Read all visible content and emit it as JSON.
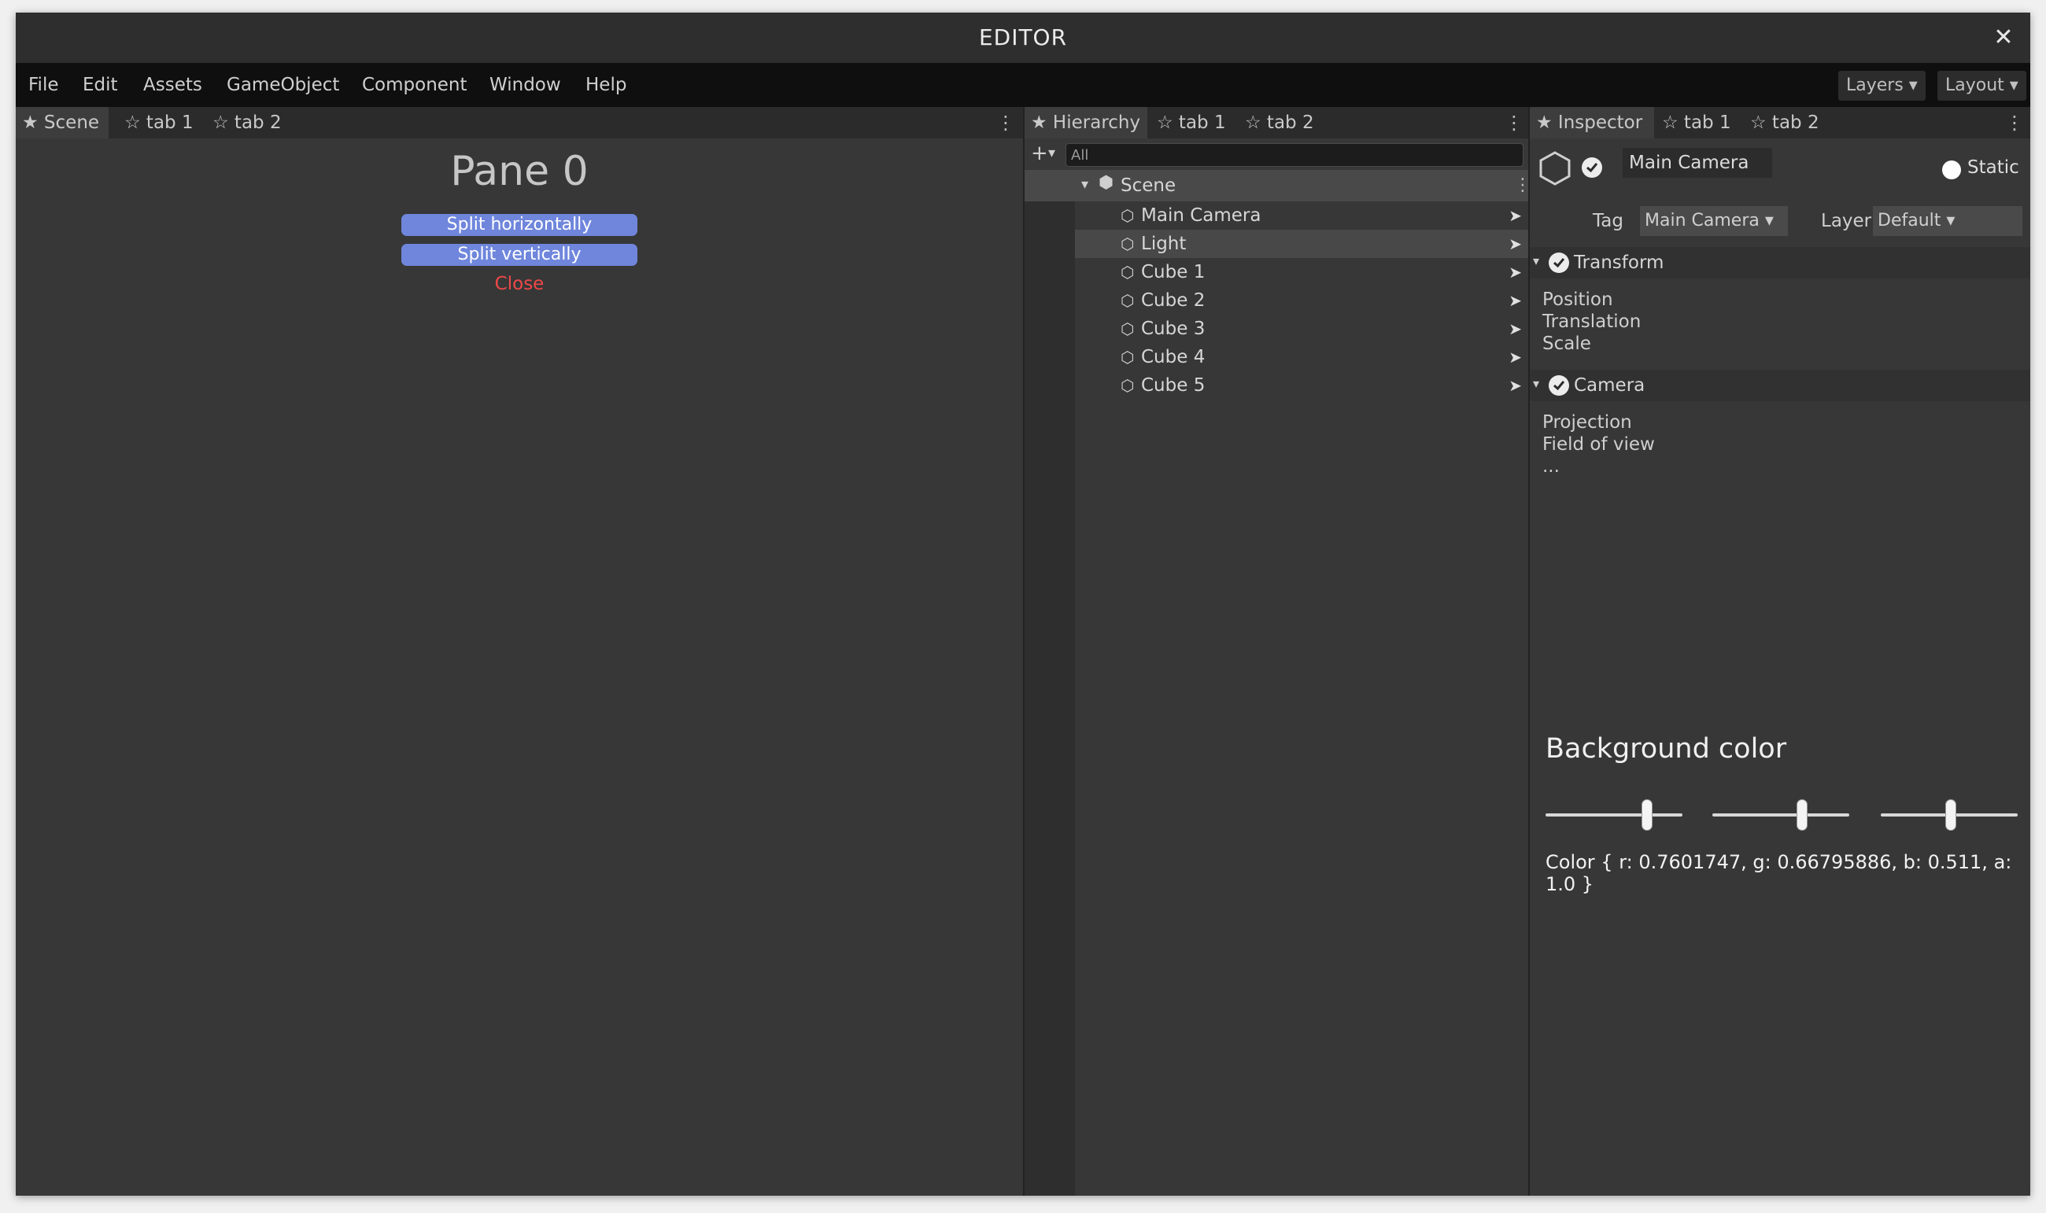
{
  "window": {
    "title": "EDITOR",
    "close_label": "✕"
  },
  "menu": {
    "items": [
      "File",
      "Edit",
      "Assets",
      "GameObject",
      "Component",
      "Window",
      "Help"
    ],
    "layers_label": "Layers ▾",
    "layout_label": "Layout ▾"
  },
  "scene_pane": {
    "tabs": [
      "★ Scene",
      "☆ tab 1",
      "☆ tab 2"
    ],
    "menu_glyph": "⋮",
    "title": "Pane 0",
    "split_h_label": "Split horizontally",
    "split_v_label": "Split vertically",
    "close_label": "Close"
  },
  "hierarchy": {
    "tabs": [
      "★ Hierarchy",
      "☆ tab 1",
      "☆ tab 2"
    ],
    "menu_glyph": "⋮",
    "add_glyph": "+",
    "dropdown_glyph": "▾",
    "search_placeholder": "All",
    "scene_caret": "▾",
    "scene_icon": "⬢",
    "scene_label": "Scene",
    "scene_menu_glyph": "⋮",
    "item_icon": "⬡",
    "item_arrow": "➤",
    "items": [
      "Main Camera",
      "Light",
      "Cube 1",
      "Cube 2",
      "Cube 3",
      "Cube 4",
      "Cube 5"
    ],
    "selected_index": 1
  },
  "inspector": {
    "tabs": [
      "★ Inspector",
      "☆ tab 1",
      "☆ tab 2"
    ],
    "menu_glyph": "⋮",
    "object_name": "Main Camera",
    "static_label": "Static",
    "tag_label": "Tag",
    "tag_value": "Main Camera ▾",
    "layer_label": "Layer",
    "layer_value": "Default ▾",
    "section_caret": "▾",
    "sections": [
      {
        "title": "Transform",
        "props": [
          "Position",
          "Translation",
          "Scale"
        ]
      },
      {
        "title": "Camera",
        "props": [
          "Projection",
          "Field of view",
          "..."
        ]
      }
    ],
    "background_color_title": "Background color",
    "sliders": [
      0.7601747,
      0.66795886,
      0.511
    ],
    "color_text": "Color { r: 0.7601747, g: 0.66795886, b: 0.511, a: 1.0 }"
  }
}
